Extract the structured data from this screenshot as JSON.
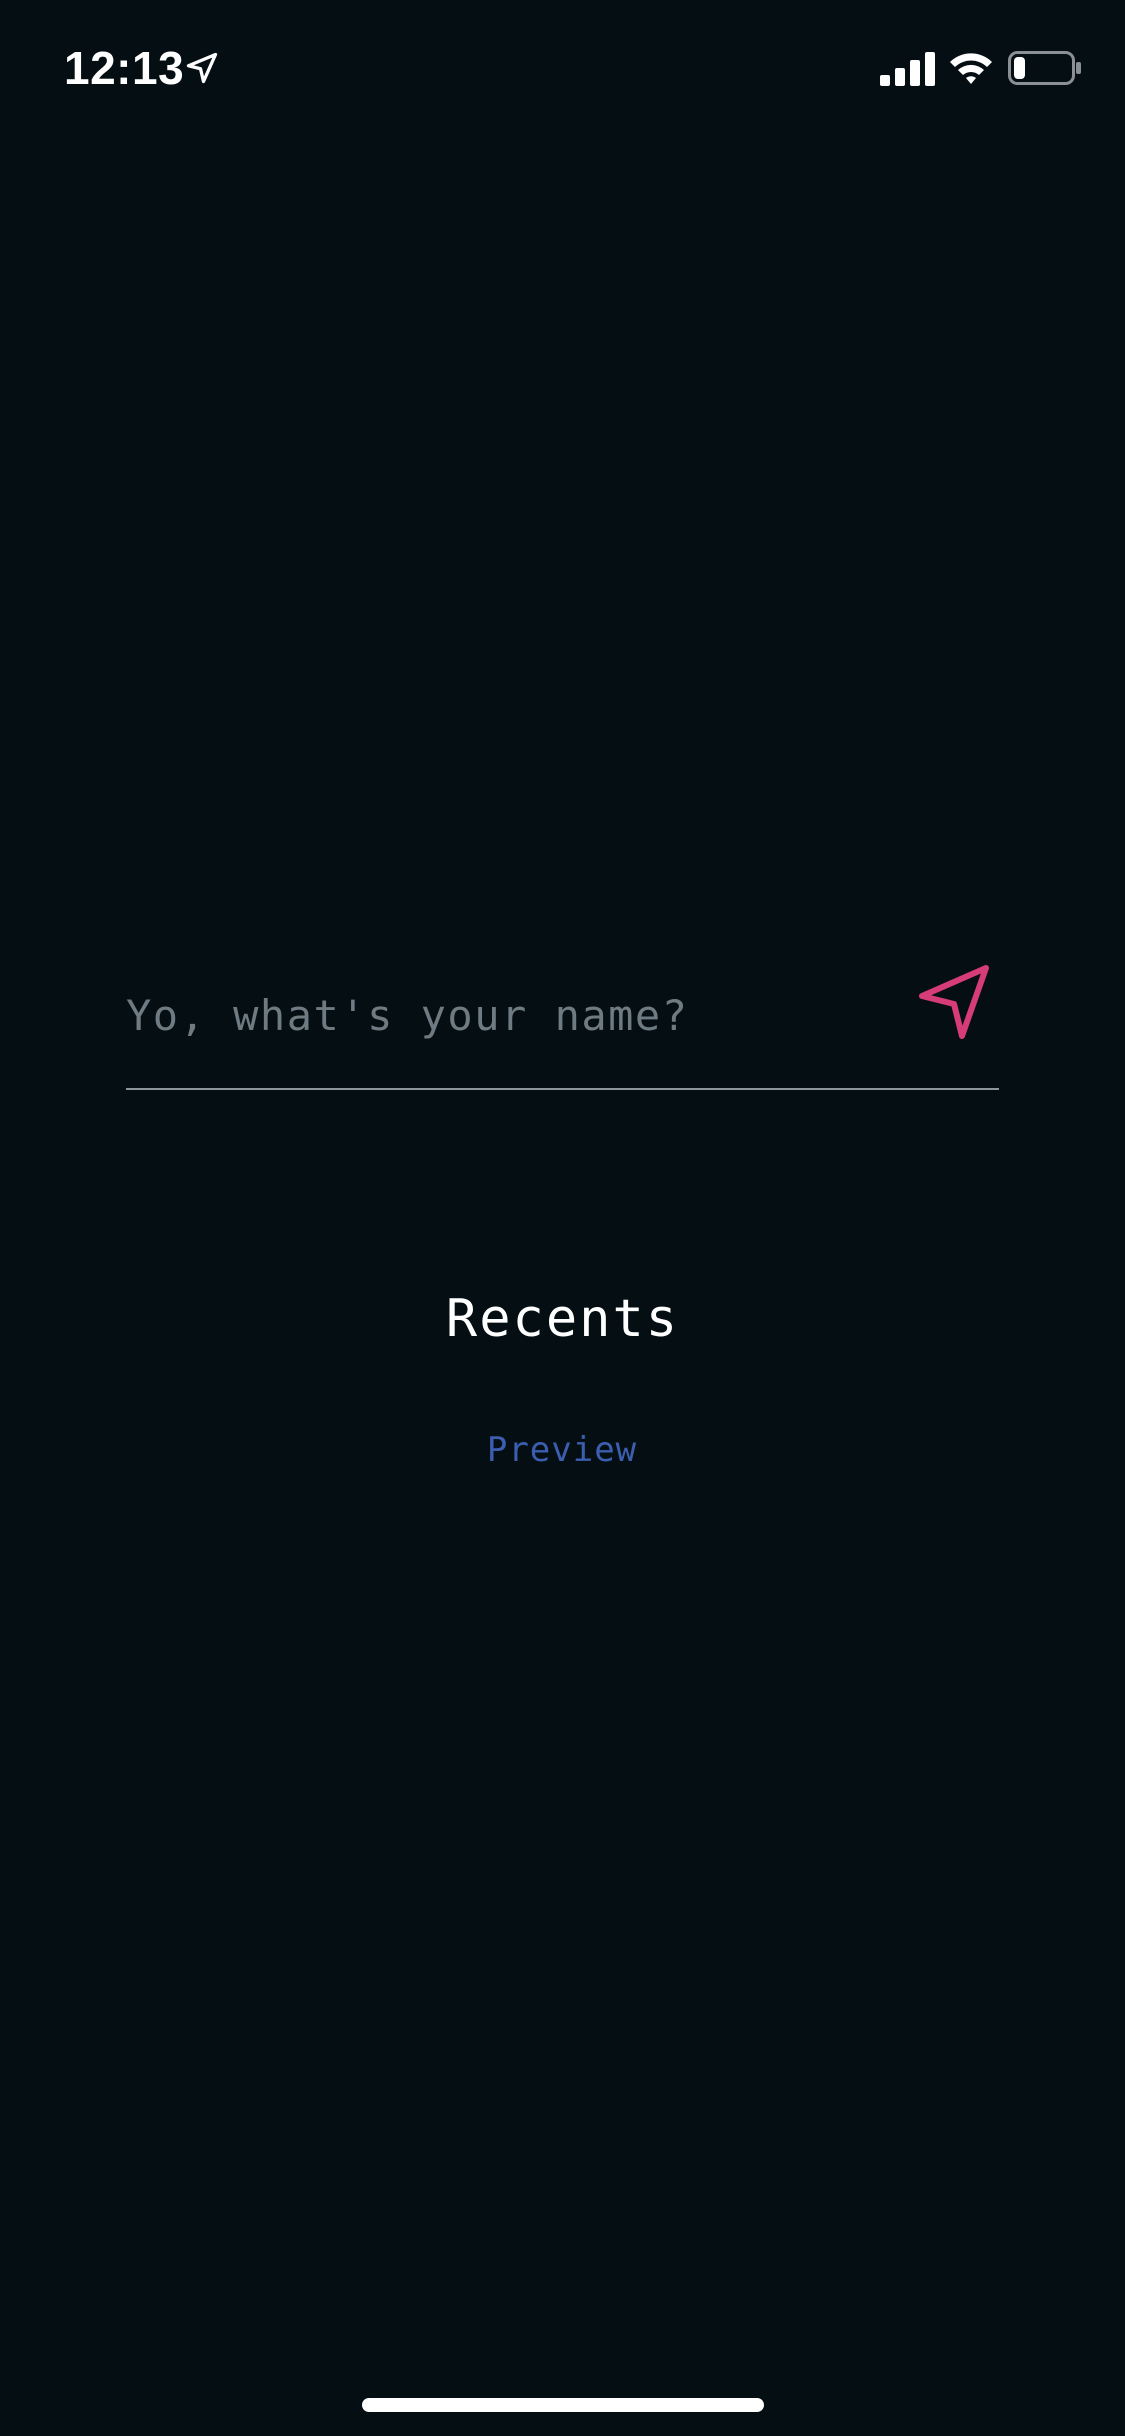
{
  "status_bar": {
    "time": "12:13",
    "icons": [
      "location-arrow-icon",
      "cellular-signal-icon",
      "wifi-icon",
      "battery-icon"
    ],
    "battery_level_fraction": 0.2
  },
  "name_prompt": {
    "placeholder": "Yo, what's your name?",
    "value": "",
    "send_icon": "send-icon"
  },
  "recents": {
    "title": "Recents",
    "items": [
      {
        "label": "Preview"
      }
    ]
  },
  "colors": {
    "background": "#050f13",
    "accent_send": "#d63c75",
    "link": "#3b5eb0",
    "placeholder": "#6f7b83",
    "underline": "#8c969c",
    "text": "#ffffff"
  }
}
